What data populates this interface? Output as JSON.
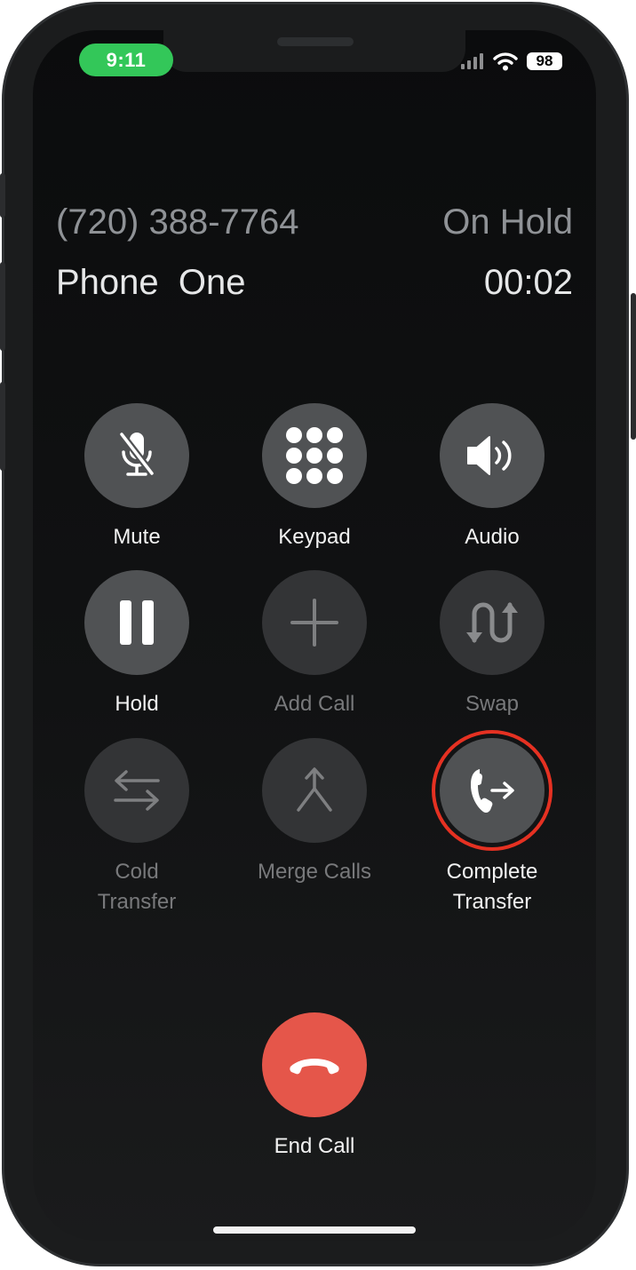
{
  "status_bar": {
    "time": "9:11",
    "battery": "98",
    "time_pill_color": "#33c759"
  },
  "call": {
    "number": "(720) 388-7764",
    "state": "On Hold",
    "name": "Phone  One",
    "duration": "00:02"
  },
  "controls": [
    {
      "label": "Mute",
      "icon": "mic-slash-icon",
      "state": "active"
    },
    {
      "label": "Keypad",
      "icon": "keypad-icon",
      "state": "active"
    },
    {
      "label": "Audio",
      "icon": "speaker-icon",
      "state": "active"
    },
    {
      "label": "Hold",
      "icon": "pause-icon",
      "state": "active"
    },
    {
      "label": "Add Call",
      "icon": "plus-icon",
      "state": "disabled"
    },
    {
      "label": "Swap",
      "icon": "swap-arrows-icon",
      "state": "disabled"
    },
    {
      "label": "Cold\nTransfer",
      "icon": "transfer-arrows-icon",
      "state": "disabled"
    },
    {
      "label": "Merge Calls",
      "icon": "merge-icon",
      "state": "disabled"
    },
    {
      "label": "Complete\nTransfer",
      "icon": "phone-transfer-icon",
      "state": "active",
      "highlighted": true
    }
  ],
  "end_call": {
    "label": "End Call",
    "icon": "phone-hangup-icon",
    "color": "#e5564a"
  },
  "highlight_color": "#e53122"
}
